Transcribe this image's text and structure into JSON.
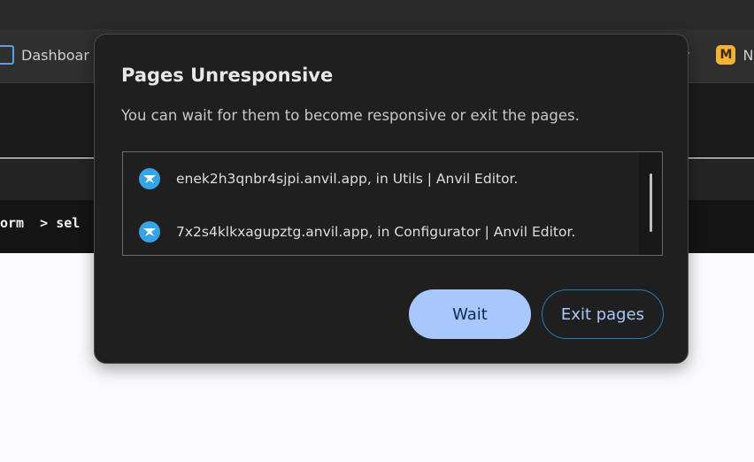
{
  "browser": {
    "bookmark_left": "Dashboar",
    "bookmark_right_tail": "y",
    "bookmark_right_badge": "M",
    "bookmark_right_partial": "N"
  },
  "editor": {
    "breadcrumb_left": "orm",
    "breadcrumb_sep": ">",
    "breadcrumb_right": "sel"
  },
  "dialog": {
    "title": "Pages Unresponsive",
    "message": "You can wait for them to become responsive or exit the pages.",
    "pages": [
      {
        "label": "enek2h3qnbr4sjpi.anvil.app, in Utils | Anvil Editor.",
        "icon": "anvil-icon"
      },
      {
        "label": "7x2s4klkxagupztg.anvil.app, in Configurator | Anvil Editor.",
        "icon": "anvil-icon"
      }
    ],
    "buttons": {
      "wait": "Wait",
      "exit": "Exit pages"
    }
  },
  "colors": {
    "dialog_bg": "#1f1f1f",
    "primary_button": "#a8c7fa",
    "icon_accent": "#34a5e6"
  }
}
